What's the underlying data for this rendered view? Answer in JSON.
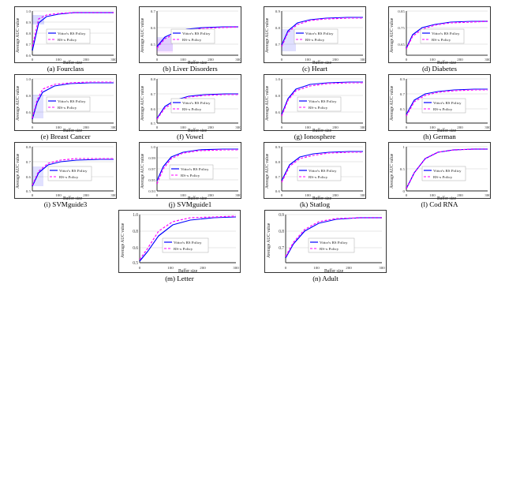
{
  "charts": [
    {
      "id": "a",
      "label": "(a) Fourclass",
      "ymin": "0.6",
      "ymax": "1.0",
      "yticks": [
        "1.0",
        "0.9",
        "0.8",
        "0.7",
        "0.6"
      ],
      "width": 130,
      "height": 72
    },
    {
      "id": "b",
      "label": "(b) Liver Disorders",
      "ymin": "0.5",
      "ymax": "0.7",
      "yticks": [
        "0.7",
        "0.6",
        "0.5"
      ],
      "width": 130,
      "height": 72
    },
    {
      "id": "c",
      "label": "(c) Heart",
      "ymin": "0.7",
      "ymax": "0.9",
      "yticks": [
        "0.9",
        "0.8",
        "0.7"
      ],
      "width": 130,
      "height": 72
    },
    {
      "id": "d",
      "label": "(d) Diabetes",
      "ymin": "0.65",
      "ymax": "0.85",
      "yticks": [
        "0.85",
        "0.75",
        "0.65"
      ],
      "width": 130,
      "height": 72
    },
    {
      "id": "e",
      "label": "(e) Breast Cancer",
      "ymin": "0.5",
      "ymax": "1.0",
      "yticks": [
        "1.0",
        "0.8",
        "0.6"
      ],
      "width": 130,
      "height": 72
    },
    {
      "id": "f",
      "label": "(f) Vowel",
      "ymin": "0.5",
      "ymax": "0.8",
      "yticks": [
        "0.8",
        "0.7",
        "0.6",
        "0.5"
      ],
      "width": 130,
      "height": 72
    },
    {
      "id": "g",
      "label": "(g) Ionosphere",
      "ymin": "0.5",
      "ymax": "1.0",
      "yticks": [
        "1.0",
        "0.8",
        "0.6"
      ],
      "width": 130,
      "height": 72
    },
    {
      "id": "h",
      "label": "(h) German",
      "ymin": "0.5",
      "ymax": "0.9",
      "yticks": [
        "0.9",
        "0.7",
        "0.5"
      ],
      "width": 130,
      "height": 72
    },
    {
      "id": "i",
      "label": "(i) SVMguide3",
      "ymin": "0.5",
      "ymax": "0.8",
      "yticks": [
        "0.8",
        "0.7",
        "0.6",
        "0.5"
      ],
      "width": 130,
      "height": 72
    },
    {
      "id": "j",
      "label": "(j) SVMguide1",
      "ymin": "0.93",
      "ymax": "1.0",
      "yticks": [
        "1.0",
        "0.99",
        "0.97",
        "0.95",
        "0.93"
      ],
      "width": 130,
      "height": 72
    },
    {
      "id": "k",
      "label": "(k) Statlog",
      "ymin": "0.6",
      "ymax": "0.9",
      "yticks": [
        "0.9",
        "0.8",
        "0.7",
        "0.6"
      ],
      "width": 130,
      "height": 72
    },
    {
      "id": "l",
      "label": "(l) Cod RNA",
      "ymin": "0.0",
      "ymax": "1.0",
      "yticks": [
        "1",
        "0.5",
        "0"
      ],
      "width": 130,
      "height": 72
    },
    {
      "id": "m",
      "label": "(m) Letter",
      "ymin": "0.5",
      "ymax": "1.0",
      "yticks": [
        "1.0",
        "0.8",
        "0.6"
      ],
      "width": 160,
      "height": 72
    },
    {
      "id": "n",
      "label": "(n) Adult",
      "ymin": "0.7",
      "ymax": "0.9",
      "yticks": [
        "0.9",
        "0.8",
        "0.7"
      ],
      "width": 160,
      "height": 72
    }
  ],
  "legend": {
    "line1": "Vitter's RS Policy",
    "line2": "RS-x Policy"
  },
  "axis_x_label": "Buffer size",
  "axis_y_label": "Average AUC value"
}
